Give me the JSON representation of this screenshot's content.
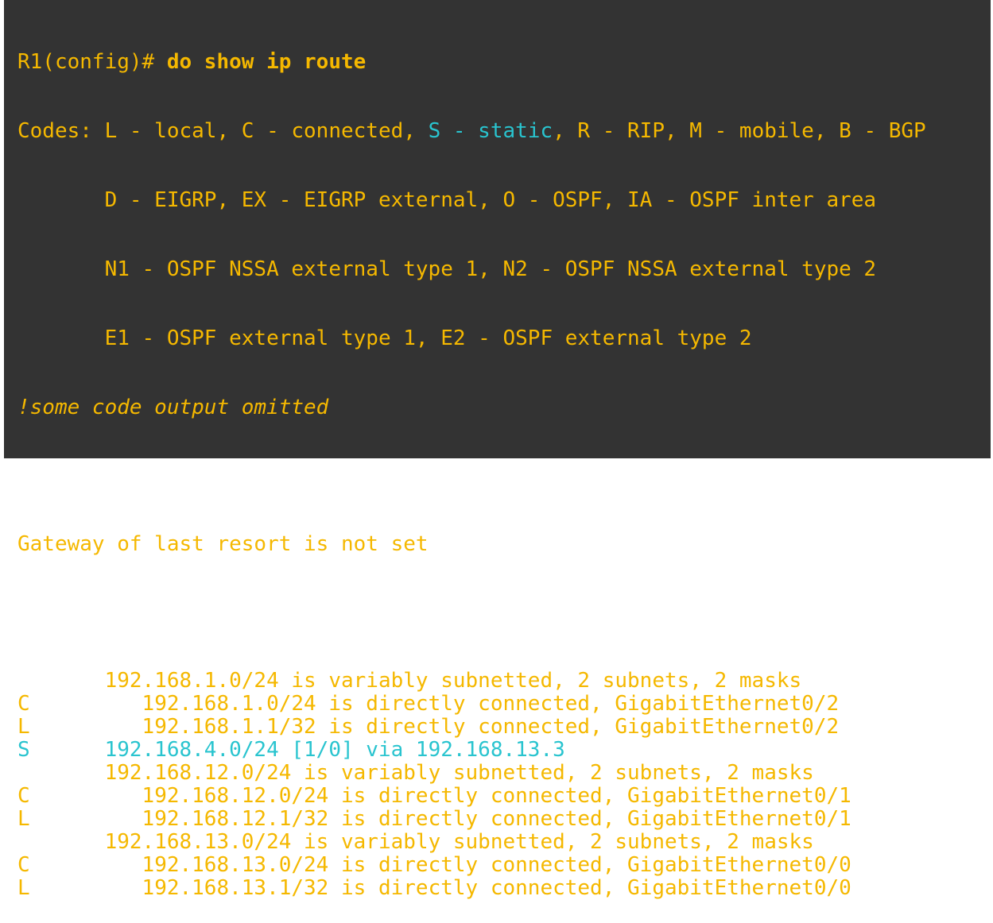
{
  "colors": {
    "background": "#333333",
    "text": "#f5b800",
    "static_highlight": "#29c4cf"
  },
  "prompt": "R1(config)#",
  "command": " do show ip route",
  "codes": {
    "line1_a": "Codes: L - local, C - connected, ",
    "line1_static": "S - static",
    "line1_b": ", R - RIP, M - mobile, B - BGP",
    "line2": "       D - EIGRP, EX - EIGRP external, O - OSPF, IA - OSPF inter area",
    "line3": "       N1 - OSPF NSSA external type 1, N2 - OSPF NSSA external type 2",
    "line4": "       E1 - OSPF external type 1, E2 - OSPF external type 2"
  },
  "comment": "!some code output omitted",
  "gateway": "Gateway of last resort is not set",
  "routes": [
    {
      "code": "",
      "text": "      192.168.1.0/24 is variably subnetted, 2 subnets, 2 masks",
      "static": false
    },
    {
      "code": "C",
      "text": "         192.168.1.0/24 is directly connected, GigabitEthernet0/2",
      "static": false
    },
    {
      "code": "L",
      "text": "         192.168.1.1/32 is directly connected, GigabitEthernet0/2",
      "static": false
    },
    {
      "code": "S",
      "text": "      192.168.4.0/24 [1/0] via 192.168.13.3",
      "static": true
    },
    {
      "code": "",
      "text": "      192.168.12.0/24 is variably subnetted, 2 subnets, 2 masks",
      "static": false
    },
    {
      "code": "C",
      "text": "         192.168.12.0/24 is directly connected, GigabitEthernet0/1",
      "static": false
    },
    {
      "code": "L",
      "text": "         192.168.12.1/32 is directly connected, GigabitEthernet0/1",
      "static": false
    },
    {
      "code": "",
      "text": "      192.168.13.0/24 is variably subnetted, 2 subnets, 2 masks",
      "static": false
    },
    {
      "code": "C",
      "text": "         192.168.13.0/24 is directly connected, GigabitEthernet0/0",
      "static": false
    },
    {
      "code": "L",
      "text": "         192.168.13.1/32 is directly connected, GigabitEthernet0/0",
      "static": false
    }
  ]
}
